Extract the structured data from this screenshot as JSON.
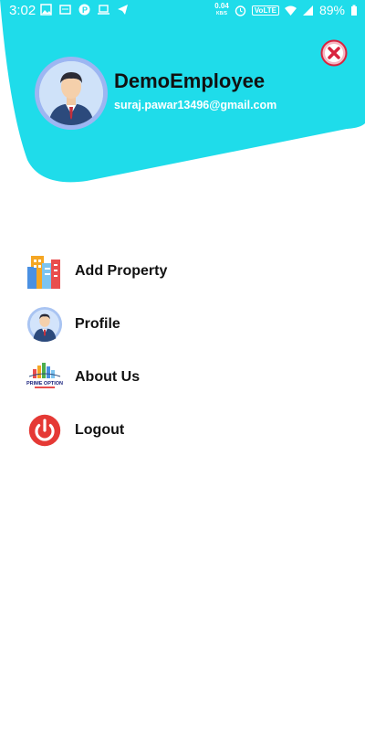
{
  "status_bar": {
    "time": "3:02",
    "net_speed_value": "0.04",
    "net_speed_unit": "KB/S",
    "network_label": "VoLTE",
    "battery": "89%"
  },
  "drawer_header": {
    "user_name": "DemoEmployee",
    "user_email": "suraj.pawar13496@gmail.com",
    "accent_color": "#1fdcea"
  },
  "menu": {
    "items": [
      {
        "label": "Add Property",
        "icon": "buildings-icon"
      },
      {
        "label": "Profile",
        "icon": "profile-avatar-icon"
      },
      {
        "label": "About Us",
        "icon": "company-logo-icon"
      },
      {
        "label": "Logout",
        "icon": "power-icon"
      }
    ],
    "logo_text": "PRIME OPTION"
  }
}
